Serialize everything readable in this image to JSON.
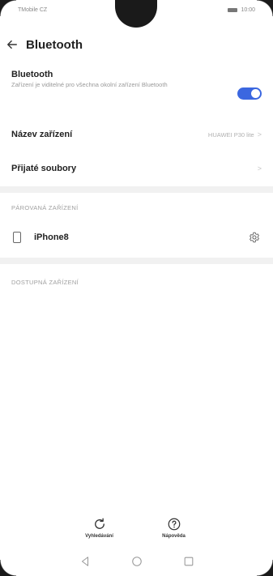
{
  "status_bar": {
    "carrier": "TMobile CZ",
    "time": "10:00"
  },
  "header": {
    "back_icon": "arrow-left-icon",
    "title": "Bluetooth"
  },
  "bluetooth": {
    "label": "Bluetooth",
    "description": "Zařízení je viditelné pro všechna okolní zařízení Bluetooth",
    "enabled": true,
    "toggle_color": "#3b67e0"
  },
  "device_name": {
    "label": "Název zařízení",
    "value": "HUAWEI P30 lite"
  },
  "received_files": {
    "label": "Přijaté soubory"
  },
  "paired_section": {
    "label": "PÁROVANÁ ZAŘÍZENÍ",
    "devices": [
      {
        "name": "iPhone8",
        "icon": "smartphone-icon",
        "settings_icon": "gear-icon"
      }
    ]
  },
  "available_section": {
    "label": "DOSTUPNÁ ZAŘÍZENÍ"
  },
  "bottom_actions": [
    {
      "label": "Vyhledávání",
      "icon": "refresh-icon"
    },
    {
      "label": "Nápověda",
      "icon": "help-icon"
    }
  ],
  "navigation": {
    "back_icon": "nav-back-icon",
    "home_icon": "nav-home-icon",
    "recents_icon": "nav-recents-icon"
  }
}
